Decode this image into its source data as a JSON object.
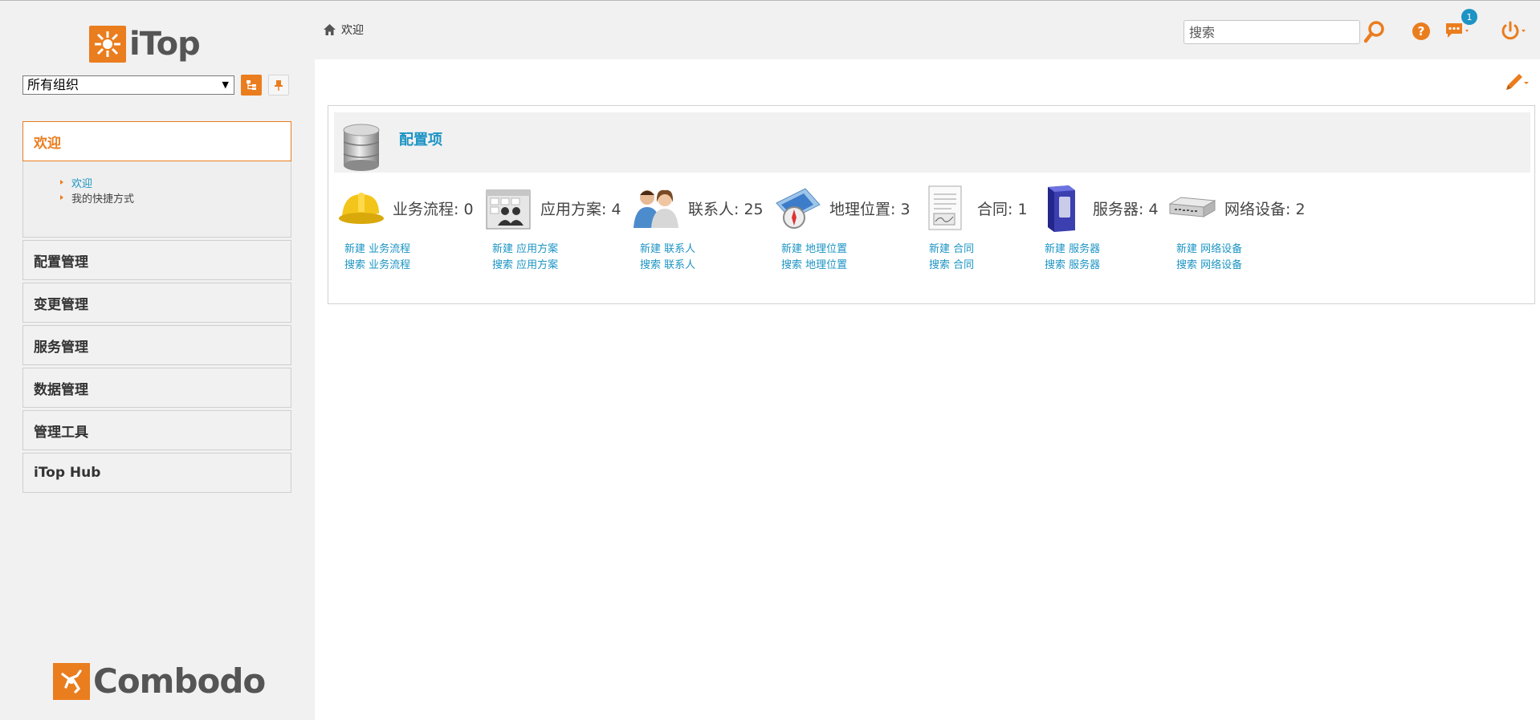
{
  "app": {
    "logo_text": "iTop",
    "footer_logo_text": "Combodo"
  },
  "org_filter": {
    "selected": "所有组织"
  },
  "menu": {
    "groups": [
      {
        "label": "欢迎",
        "active": true
      },
      {
        "label": "配置管理"
      },
      {
        "label": "变更管理"
      },
      {
        "label": "服务管理"
      },
      {
        "label": "数据管理"
      },
      {
        "label": "管理工具"
      },
      {
        "label": "iTop Hub"
      }
    ],
    "welcome_items": [
      {
        "label": "欢迎",
        "current": true
      },
      {
        "label": "我的快捷方式"
      }
    ]
  },
  "breadcrumb": {
    "label": "欢迎"
  },
  "search": {
    "placeholder": "搜索"
  },
  "notifications": {
    "count": "1"
  },
  "dashlet": {
    "title": "配置项",
    "items": [
      {
        "label": "业务流程: 0",
        "icon": "hardhat-icon",
        "new_link": "新建 业务流程",
        "search_link": "搜索 业务流程"
      },
      {
        "label": "应用方案: 4",
        "icon": "application-solution-icon",
        "new_link": "新建 应用方案",
        "search_link": "搜索 应用方案"
      },
      {
        "label": "联系人: 25",
        "icon": "contacts-icon",
        "new_link": "新建 联系人",
        "search_link": "搜索 联系人"
      },
      {
        "label": "地理位置: 3",
        "icon": "location-compass-icon",
        "new_link": "新建 地理位置",
        "search_link": "搜索 地理位置"
      },
      {
        "label": "合同: 1",
        "icon": "contract-document-icon",
        "new_link": "新建 合同",
        "search_link": "搜索 合同"
      },
      {
        "label": "服务器: 4",
        "icon": "server-icon",
        "new_link": "新建 服务器",
        "search_link": "搜索 服务器"
      },
      {
        "label": "网络设备: 2",
        "icon": "network-device-icon",
        "new_link": "新建 网络设备",
        "search_link": "搜索 网络设备"
      }
    ]
  },
  "colors": {
    "accent": "#ea7d1e",
    "link": "#1c94c4",
    "pane_bg": "#f1f1f1"
  }
}
